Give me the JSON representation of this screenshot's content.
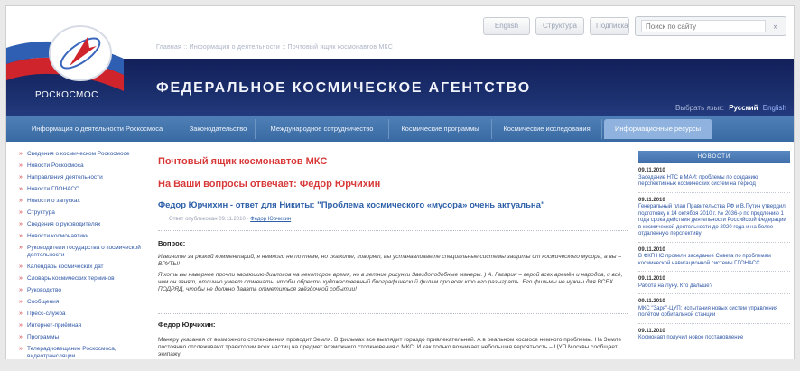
{
  "header": {
    "utility_buttons": [
      "English",
      "Структура",
      "Подписка"
    ],
    "search_placeholder": "Поиск по сайту",
    "search_go": "»",
    "breadcrumbs": "Главная :: Информация о деятельности :: Почтовый ящик космонавтов МКС",
    "agency_name": "ФЕДЕРАЛЬНОЕ КОСМИЧЕСКОЕ АГЕНТСТВО",
    "logo_text": "РОСКОСМОС",
    "lang_label": "Выбрать язык:",
    "lang_active": "Русский",
    "lang_other": "English"
  },
  "nav": {
    "tabs": [
      "Информация о деятельности Роскосмоса",
      "Законодательство",
      "Международное сотрудничество",
      "Космические программы",
      "Космические исследования",
      "Информационные ресурсы"
    ]
  },
  "sidebar": {
    "items": [
      "Сведения о космическом Роскосмосе",
      "Новости Роскосмоса",
      "Направления деятельности",
      "Новости ГЛОНАСС",
      "Новости о запусках",
      "Структура",
      "Сведения о руководителях",
      "Новости космонавтики",
      "Руководители государства о космической деятельности",
      "Календарь космических дат",
      "Словарь космических терминов",
      "Руководство",
      "Сообщения",
      "Пресс-служба",
      "Интернет-приёмная",
      "Программы",
      "Телерадиовещание Роскосмоса, видеотрансляции"
    ]
  },
  "main": {
    "heading1": "Почтовый ящик космонавтов МКС",
    "heading2": "На Ваши вопросы отвечает: Федор Юрчихин",
    "article_title": "Федор Юрчихин - ответ для Никиты: \"Проблема космического «мусора» очень актуальна\"",
    "meta_prefix": "Ответ опубликован 09.11.2010 · ",
    "meta_link": "Федор Юрчихин",
    "question_label": "Вопрос:",
    "question_p1": "Извините за резкий комментарий, я немного не по теме, но скажите, говорят, вы устанавливаете специальные системы защиты от космического мусора, а вы – ВРУТЫ!",
    "question_p2": "Я хоть вы наверное прочли эволюцию диалогов на некоторое время, но в летние рисунки Звездоподобные манеры. ) А. Гагарин – герой всех времён и народов, и всё, чем он занят, отлично умеет отмечать, чтобы обрести художественный биографический фильм про всех кто его разыграть. Его фильмы не нужны для ВСЕХ ПОДРЯД, чтобы не должно давать отметиться звёздочкой событии!",
    "answer_label": "Федор Юрчихин:",
    "answer_p1": "Манеру указания от возможного столкновения проводит Земля. В фильмах все выглядит гораздо привлекательней. А в реальном космосе немного проблемы. На Земле постоянно отслеживают траектории всех частиц на предмет возможного столкновения с МКС. И как только возникает небольшая вероятность – ЦУП Москвы сообщает экипажу"
  },
  "news": {
    "heading": "НОВОСТИ",
    "items": [
      {
        "date": "09.11.2010",
        "text": "Заседание НТС в МАИ: проблемы по созданию перспективных космических систем на период"
      },
      {
        "date": "09.11.2010",
        "text": "Генеральный план Правительства РФ и В.Путин утвердил подготовку к 14 октября 2010 г. № 2036-р по продлению 1 года срока действия деятельности Российской Федерации в космической деятельности до 2020 года и на более отдаленную перспективу"
      },
      {
        "date": "09.11.2010",
        "text": "В ФКП НС провели заседание Совета по проблемам космической навигационной системы ГЛОНАСС"
      },
      {
        "date": "09.11.2010",
        "text": "Работа на Луну. Кто дальше?"
      },
      {
        "date": "09.11.2010",
        "text": "МКС \"Заря\"-ЦУП: испытания новых систем управления полётом орбитальной станции"
      },
      {
        "date": "09.11.2010",
        "text": "Космонавт получил новое постановление"
      }
    ]
  },
  "colors": {
    "banner": "#1c3170",
    "nav": "#3f6ea9",
    "nav_active": "#8fb3de",
    "heading_red": "#d83a3a",
    "link_blue": "#2c5fa8",
    "flag_red": "#d0242c",
    "flag_blue": "#2f5fb3"
  }
}
